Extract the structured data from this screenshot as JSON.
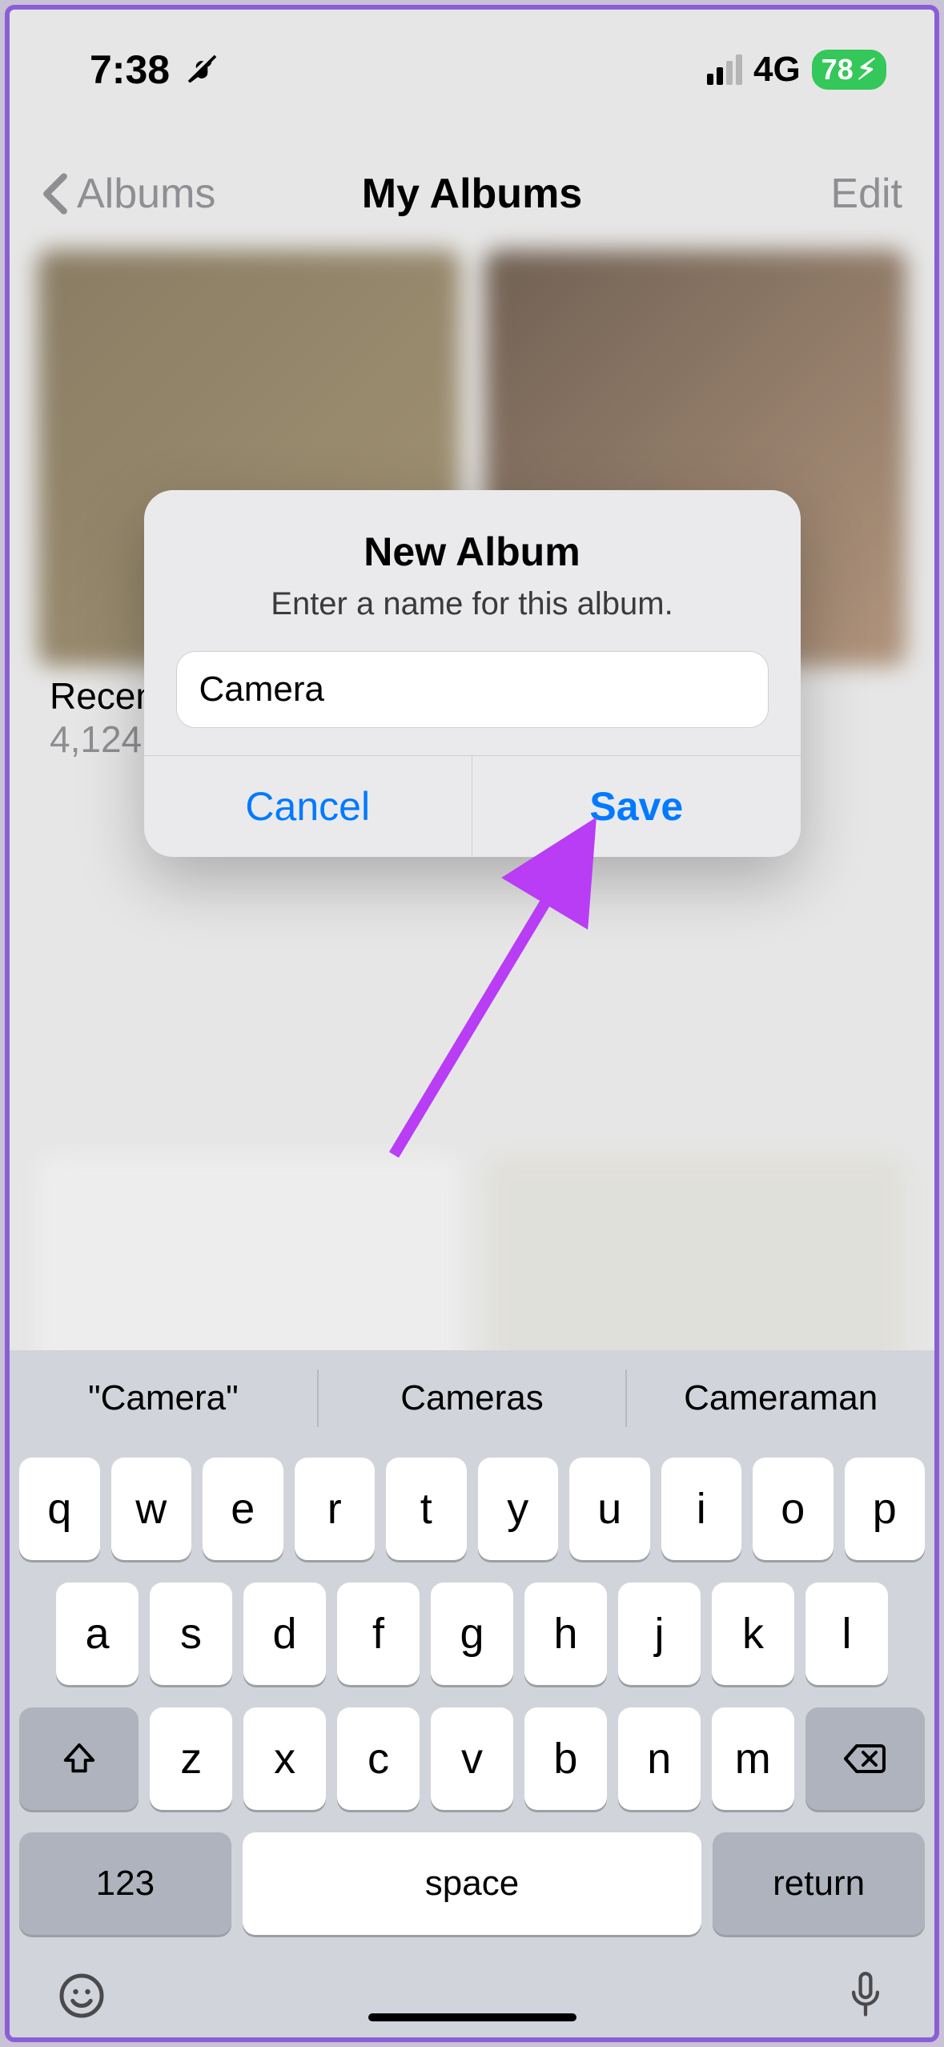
{
  "status": {
    "time": "7:38",
    "network_label": "4G",
    "battery_pct": "78",
    "battery_charging_glyph": "⚡︎"
  },
  "nav": {
    "back_label": "Albums",
    "title": "My Albums",
    "edit_label": "Edit"
  },
  "background_album": {
    "name": "Recents",
    "count": "4,124"
  },
  "alert": {
    "title": "New Album",
    "subtitle": "Enter a name for this album.",
    "input_value": "Camera",
    "cancel": "Cancel",
    "save": "Save"
  },
  "suggestions": [
    "\"Camera\"",
    "Cameras",
    "Cameraman"
  ],
  "keys": {
    "row1": [
      "q",
      "w",
      "e",
      "r",
      "t",
      "y",
      "u",
      "i",
      "o",
      "p"
    ],
    "row2": [
      "a",
      "s",
      "d",
      "f",
      "g",
      "h",
      "j",
      "k",
      "l"
    ],
    "row3": [
      "z",
      "x",
      "c",
      "v",
      "b",
      "n",
      "m"
    ],
    "numbers": "123",
    "space": "space",
    "return": "return"
  },
  "annotation": {
    "color": "#b83df5"
  }
}
